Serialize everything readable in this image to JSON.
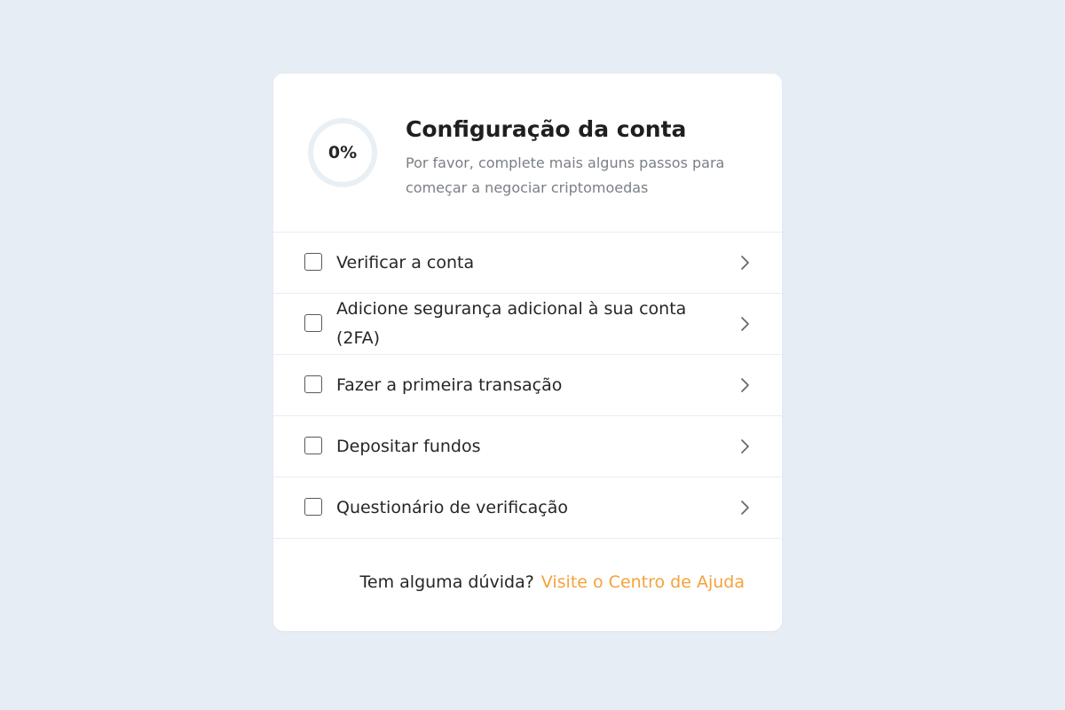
{
  "header": {
    "progress_label": "0%",
    "progress_value": 0,
    "title": "Configuração da conta",
    "subtitle": "Por favor, complete mais alguns passos para começar a negociar criptomoedas"
  },
  "tasks": [
    {
      "label": "Verificar a conta",
      "checked": false,
      "icon": "chevron-right-icon"
    },
    {
      "label": "Adicione segurança adicional à sua conta (2FA)",
      "checked": false,
      "icon": "chevron-right-icon"
    },
    {
      "label": "Fazer a primeira transação",
      "checked": false,
      "icon": "chevron-right-icon"
    },
    {
      "label": "Depositar fundos",
      "checked": false,
      "icon": "chevron-right-icon"
    },
    {
      "label": "Questionário de verificação",
      "checked": false,
      "icon": "chevron-right-icon"
    }
  ],
  "footer": {
    "question": "Tem alguma dúvida?",
    "link_label": "Visite o Centro de Ajuda"
  },
  "colors": {
    "background": "#e7edf4",
    "card": "#ffffff",
    "ring_track": "#e8eff5",
    "link": "#f5a23b",
    "text_primary": "#262626",
    "text_secondary": "#7a7f86"
  }
}
